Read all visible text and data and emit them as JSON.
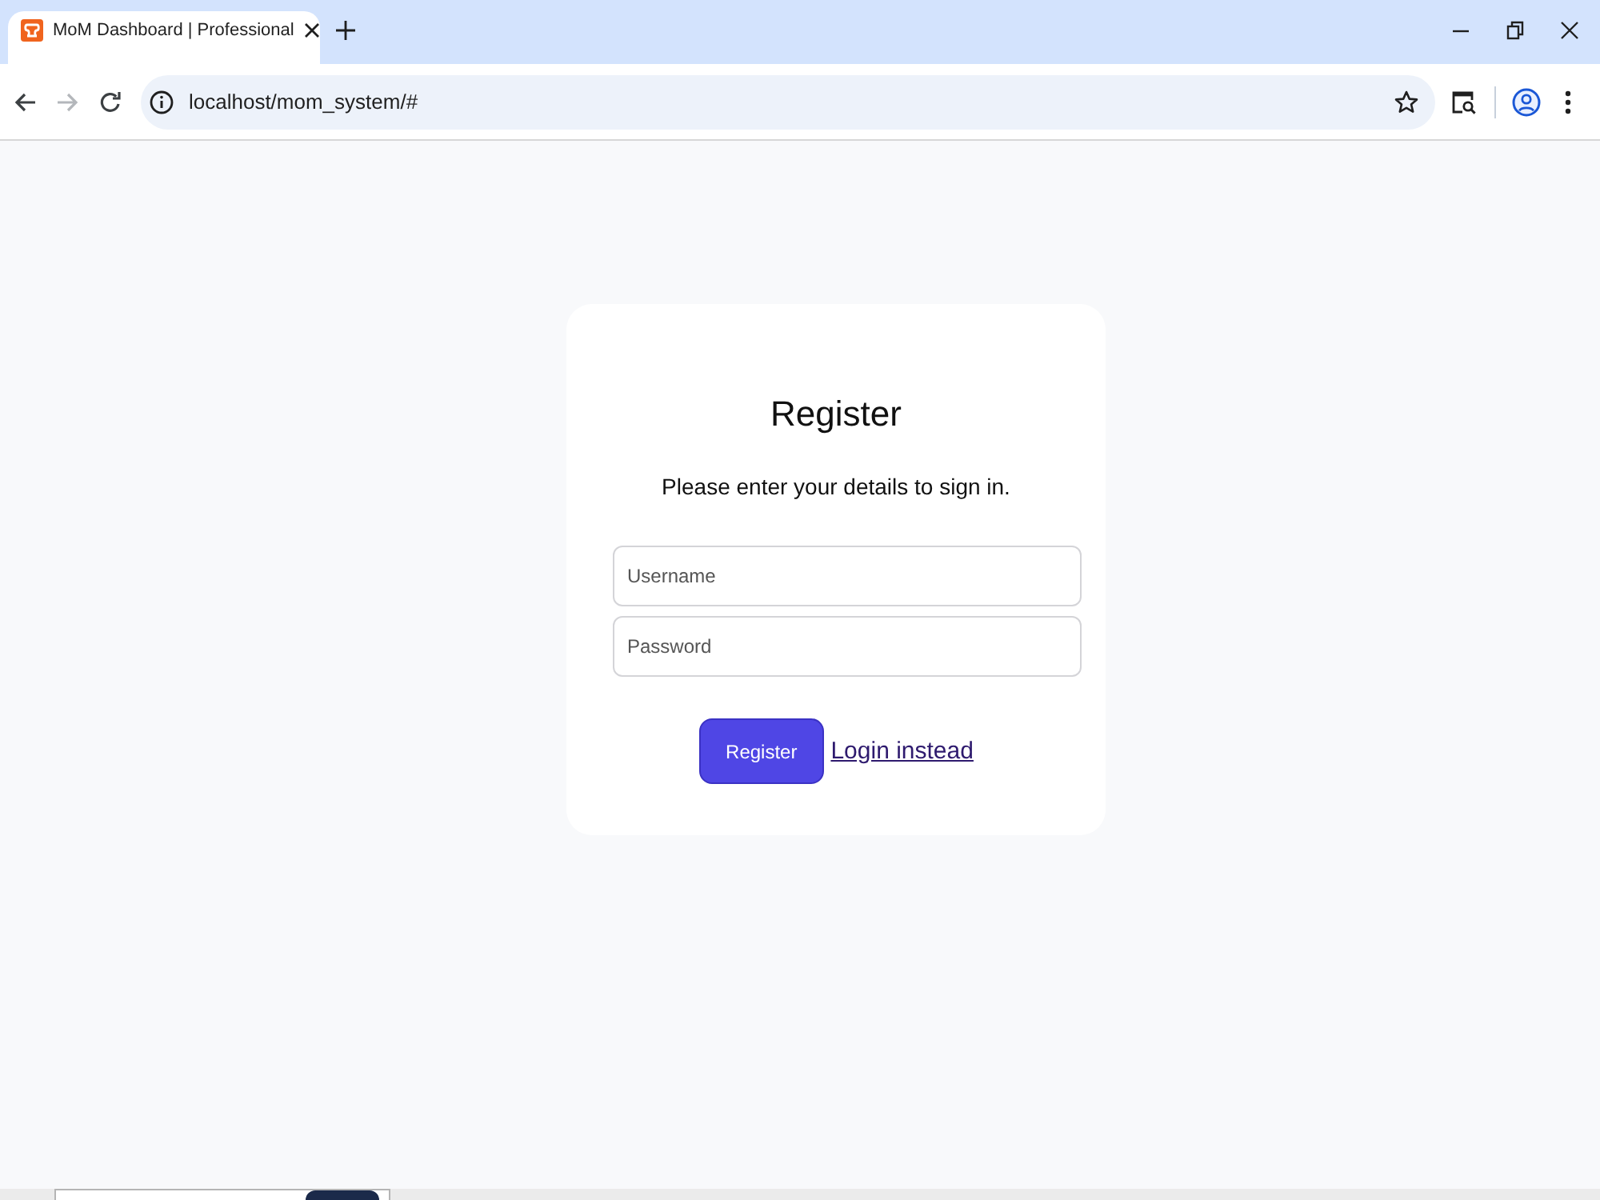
{
  "browser": {
    "tabs": [
      {
        "title": "MoM Dashboard | Professional",
        "selected": true
      }
    ],
    "nav_buttons": [
      {
        "kind": "back",
        "disabled": false
      },
      {
        "kind": "forward",
        "disabled": true
      },
      {
        "kind": "reload",
        "disabled": false
      }
    ],
    "address": "localhost/mom_system/#"
  },
  "register_form": {
    "title": "Register",
    "subtitle": "Please enter your details to sign in.",
    "fields": [
      {
        "placeholder": "Username"
      },
      {
        "placeholder": "Password"
      }
    ],
    "submit_button": "Register",
    "login_link": "Login instead"
  }
}
